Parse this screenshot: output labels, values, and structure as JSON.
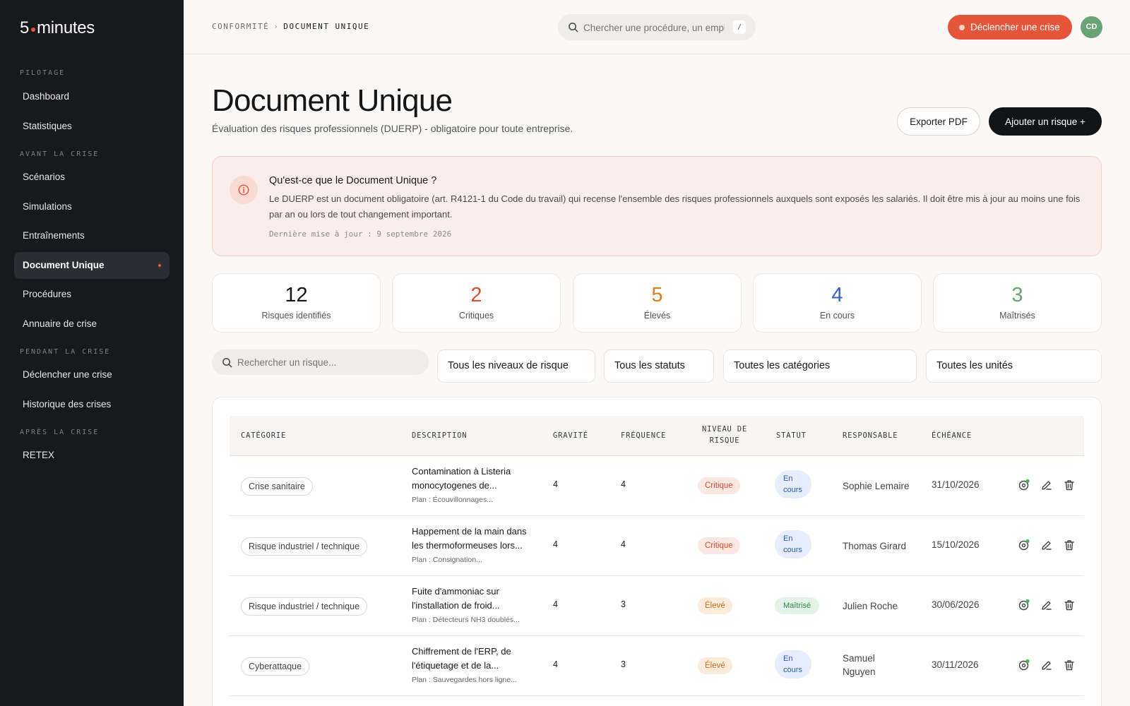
{
  "app": {
    "logo_left": "5",
    "logo_right": "minutes"
  },
  "sidebar": {
    "sections": [
      {
        "label": "PILOTAGE",
        "items": [
          {
            "label": "Dashboard"
          },
          {
            "label": "Statistiques"
          }
        ]
      },
      {
        "label": "AVANT LA CRISE",
        "items": [
          {
            "label": "Scénarios"
          },
          {
            "label": "Simulations"
          },
          {
            "label": "Entraînements"
          },
          {
            "label": "Document Unique",
            "active": true
          },
          {
            "label": "Procédures"
          },
          {
            "label": "Annuaire de crise"
          }
        ]
      },
      {
        "label": "PENDANT LA CRISE",
        "items": [
          {
            "label": "Déclencher une crise"
          },
          {
            "label": "Historique des crises"
          }
        ]
      },
      {
        "label": "APRÈS LA CRISE",
        "items": [
          {
            "label": "RETEX"
          }
        ]
      }
    ]
  },
  "topbar": {
    "breadcrumb": [
      "CONFORMITÉ",
      "DOCUMENT UNIQUE"
    ],
    "breadcrumb_sep": "›",
    "search_placeholder": "Chercher une procédure, un emploi...",
    "search_shortcut": "/",
    "crisis_button": "Déclencher une crise",
    "avatar_initials": "CD"
  },
  "header": {
    "title": "Document Unique",
    "subtitle": "Évaluation des risques professionnels (DUERP) - obligatoire pour toute entreprise.",
    "export_button": "Exporter PDF",
    "add_button": "Ajouter un risque  +"
  },
  "info": {
    "title": "Qu'est-ce que le Document Unique ?",
    "text": "Le DUERP est un document obligatoire (art. R4121-1 du Code du travail) qui recense l'ensemble des risques professionnels auxquels sont exposés les salariés. Il doit être mis à jour au moins une fois par an ou lors de tout changement important.",
    "updated": "Dernière mise à jour : 9 septembre 2026"
  },
  "stats": [
    {
      "value": "12",
      "label": "Risques identifiés",
      "color": "#161616"
    },
    {
      "value": "2",
      "label": "Critiques",
      "color": "#d9502f"
    },
    {
      "value": "5",
      "label": "Élevés",
      "color": "#d8801f"
    },
    {
      "value": "4",
      "label": "En cours",
      "color": "#2f5fd6"
    },
    {
      "value": "3",
      "label": "Maîtrisés",
      "color": "#6aa273"
    }
  ],
  "filters": {
    "search_placeholder": "Rechercher un risque...",
    "level": "Tous les niveaux de risque",
    "status": "Tous les statuts",
    "category": "Toutes les catégories",
    "unit": "Toutes les unités"
  },
  "table": {
    "headers": {
      "category": "CATÉGORIE",
      "description": "DESCRIPTION",
      "gravity": "GRAVITÉ",
      "frequency": "FRÉQUENCE",
      "level_1": "NIVEAU DE",
      "level_2": "RISQUE",
      "status": "STATUT",
      "owner": "RESPONSABLE",
      "due": "ÉCHÉANCE"
    },
    "rows": [
      {
        "category": "Crise sanitaire",
        "desc_1": "Contamination à Listeria",
        "desc_2": "monocytogenes de...",
        "plan": "Plan : Écouvillonnages...",
        "gravity": "4",
        "frequency": "4",
        "level": "Critique",
        "status_1": "En",
        "status_2": "cours",
        "owner_1": "Sophie Lemaire",
        "owner_2": "",
        "due": "31/10/2026"
      },
      {
        "category": "Risque industriel / technique",
        "desc_1": "Happement de la main dans",
        "desc_2": "les thermoformeuses lors...",
        "plan": "Plan : Consignation...",
        "gravity": "4",
        "frequency": "4",
        "level": "Critique",
        "status_1": "En",
        "status_2": "cours",
        "owner_1": "Thomas Girard",
        "owner_2": "",
        "due": "15/10/2026"
      },
      {
        "category": "Risque industriel / technique",
        "desc_1": "Fuite d'ammoniac sur",
        "desc_2": "l'installation de froid...",
        "plan": "Plan : Détecteurs NH3 doublés...",
        "gravity": "4",
        "frequency": "3",
        "level": "Élevé",
        "status_1": "Maîtrisé",
        "status_2": "",
        "owner_1": "Julien Roche",
        "owner_2": "",
        "due": "30/06/2026"
      },
      {
        "category": "Cyberattaque",
        "desc_1": "Chiffrement de l'ERP, de",
        "desc_2": "l'étiquetage et de la...",
        "plan": "Plan : Sauvegardes hors ligne...",
        "gravity": "4",
        "frequency": "3",
        "level": "Élevé",
        "status_1": "En",
        "status_2": "cours",
        "owner_1": "Samuel",
        "owner_2": "Nguyen",
        "due": "30/11/2026"
      }
    ]
  }
}
